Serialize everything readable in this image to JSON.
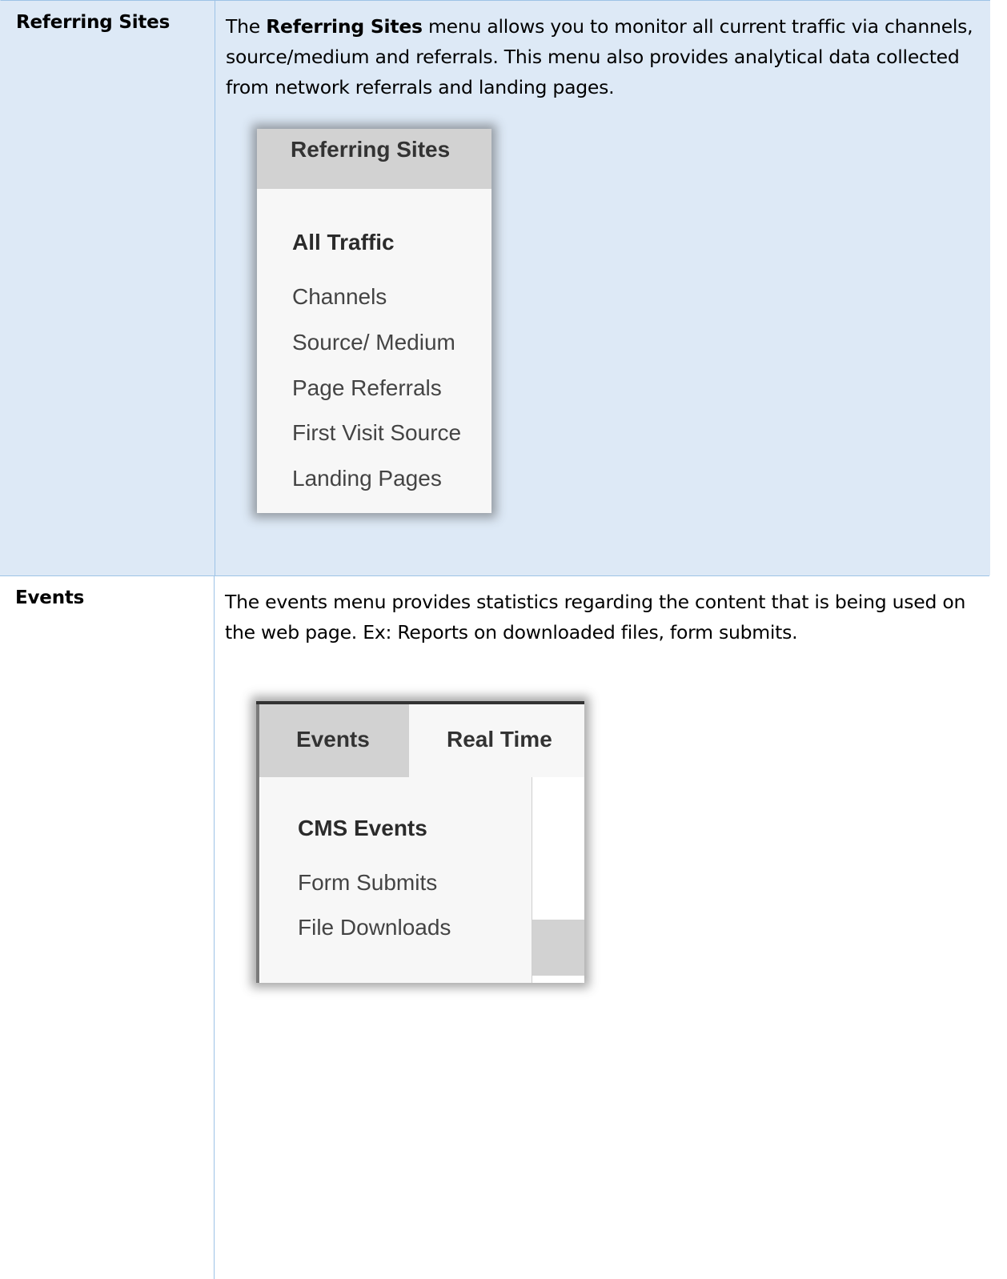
{
  "rows": [
    {
      "label": "Referring Sites",
      "description_prefix": "The ",
      "description_bold": "Referring Sites",
      "description_suffix": " menu allows you to monitor all current traffic via channels, source/medium and referrals. This menu also provides analytical data collected from network referrals and landing pages.",
      "menu": {
        "header": "Referring Sites",
        "section_title": "All Traffic",
        "items": [
          "Channels",
          "Source/ Medium",
          "Page Referrals",
          "First Visit Source",
          "Landing Pages"
        ]
      }
    },
    {
      "label": "Events",
      "description": "The events menu provides statistics regarding the content that is being used on the web page. Ex: Reports on downloaded files, form submits.",
      "menu": {
        "tabs": [
          "Events",
          "Real Time"
        ],
        "section_title": "CMS Events",
        "items": [
          "Form Submits",
          "File Downloads"
        ]
      }
    }
  ],
  "colors": {
    "row_highlight": "#dde9f6",
    "border": "#9dc3e6",
    "menu_header": "#d2d2d2",
    "menu_background": "#f7f7f7"
  }
}
